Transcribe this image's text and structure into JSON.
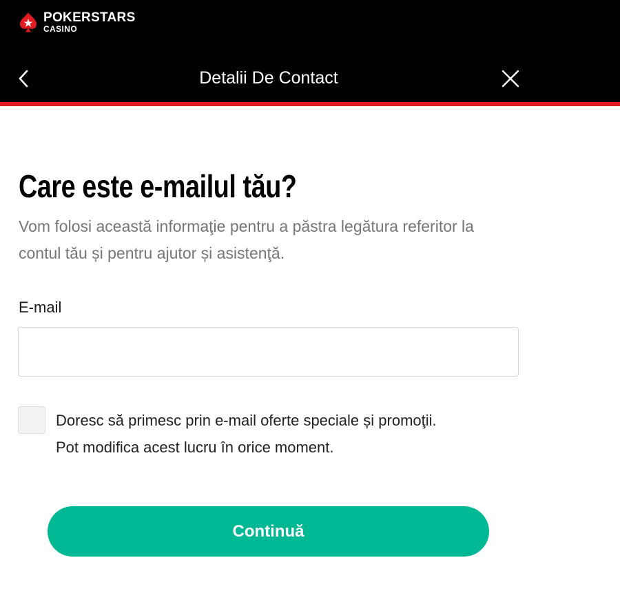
{
  "brand": {
    "line1": "POKERSTARS",
    "line2": "CASINO",
    "star_color": "#e11b22"
  },
  "header": {
    "title": "Detalii De Contact",
    "back_icon": "chevron-left-icon",
    "close_icon": "close-icon",
    "background": "#000000",
    "accent_line_color": "#e11b22"
  },
  "main": {
    "heading": "Care este e-mailul tău?",
    "subtext": "Vom folosi această informaţie pentru a păstra legătura referitor la contul tău și pentru ajutor și asistenţă.",
    "email": {
      "label": "E-mail",
      "value": "",
      "placeholder": ""
    },
    "consent": {
      "checked": false,
      "line1": "Doresc să primesc prin e-mail oferte speciale și promoţii.",
      "line2": "Pot modifica acest lucru în orice moment."
    },
    "continue_label": "Continuă",
    "button_color": "#00b894"
  }
}
